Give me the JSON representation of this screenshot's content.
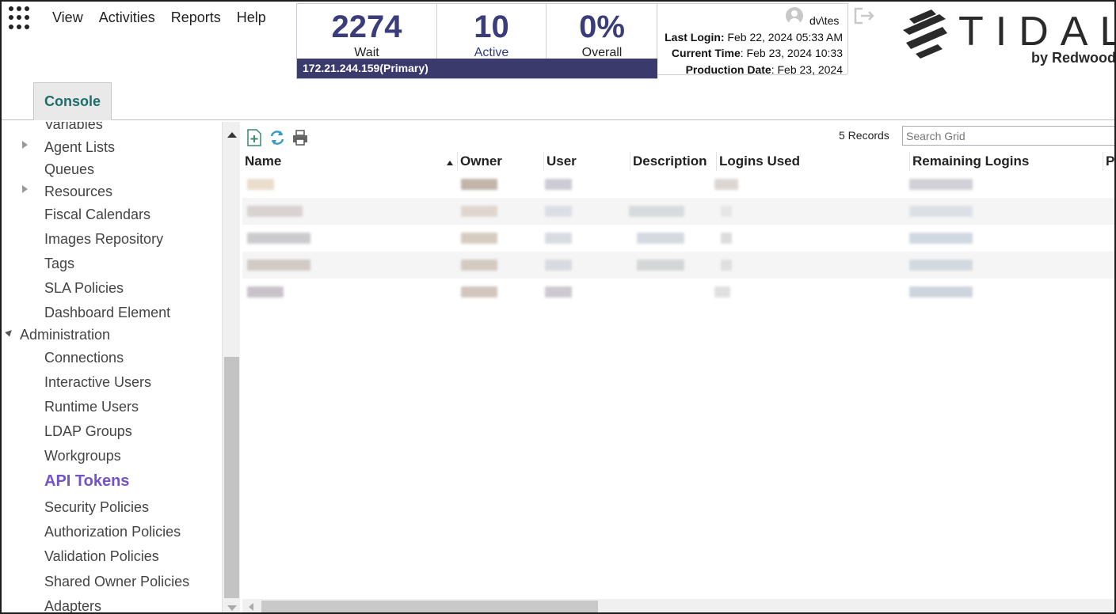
{
  "menu": {
    "app_grid_icon": "app-grid-icon",
    "items": [
      "View",
      "Activities",
      "Reports",
      "Help"
    ]
  },
  "stats": {
    "wait": {
      "value": "2274",
      "label": "Wait"
    },
    "active": {
      "value": "10",
      "label": "Active"
    },
    "overall": {
      "value": "0%",
      "label": "Overall"
    },
    "server": "172.21.244.159(Primary)"
  },
  "user": {
    "name": "dv\\tes",
    "last_login_label": "Last Login:",
    "last_login_value": " Feb 22, 2024 05:33 AM",
    "current_time_label": "Current Time",
    "current_time_value": ": Feb 23, 2024 10:33",
    "production_date_label": "Production Date",
    "production_date_value": ": Feb 23, 2024"
  },
  "logo": {
    "word": "TIDAL",
    "sub": "by Redwood"
  },
  "tabs": {
    "console": "Console"
  },
  "sidebar": {
    "items": [
      {
        "label": "Variables",
        "expandable": false
      },
      {
        "label": "Agent Lists",
        "expandable": true
      },
      {
        "label": "Queues",
        "expandable": false
      },
      {
        "label": "Resources",
        "expandable": true
      },
      {
        "label": "Fiscal Calendars",
        "expandable": false
      },
      {
        "label": "Images Repository",
        "expandable": false
      },
      {
        "label": "Tags",
        "expandable": false
      },
      {
        "label": "SLA Policies",
        "expandable": false
      },
      {
        "label": "Dashboard Element",
        "expandable": false
      },
      {
        "label": "Administration",
        "expandable": true,
        "expanded": true
      },
      {
        "label": "Connections",
        "expandable": false
      },
      {
        "label": "Interactive Users",
        "expandable": false
      },
      {
        "label": "Runtime Users",
        "expandable": false
      },
      {
        "label": "LDAP Groups",
        "expandable": false
      },
      {
        "label": "Workgroups",
        "expandable": false
      },
      {
        "label": "API Tokens",
        "expandable": false,
        "active": true
      },
      {
        "label": "Security Policies",
        "expandable": false
      },
      {
        "label": "Authorization Policies",
        "expandable": false
      },
      {
        "label": "Validation Policies",
        "expandable": false
      },
      {
        "label": "Shared Owner Policies",
        "expandable": false
      },
      {
        "label": "Adapters",
        "expandable": false
      }
    ],
    "active_color": "#7453c9"
  },
  "grid": {
    "records": "5 Records",
    "search_placeholder": "Search Grid",
    "columns": [
      "Name",
      "Owner",
      "User",
      "Description",
      "Logins Used",
      "Remaining Logins",
      "Pr"
    ],
    "sorted_column": "Name",
    "sort_direction": "ascending",
    "row_count": 5,
    "toolbar_icons": [
      "add-icon",
      "refresh-icon",
      "print-icon"
    ]
  },
  "colors": {
    "stat_number": "#3b3d7a",
    "server_bar": "#3b3a6c",
    "console_tab_text": "#1b6e6b"
  }
}
